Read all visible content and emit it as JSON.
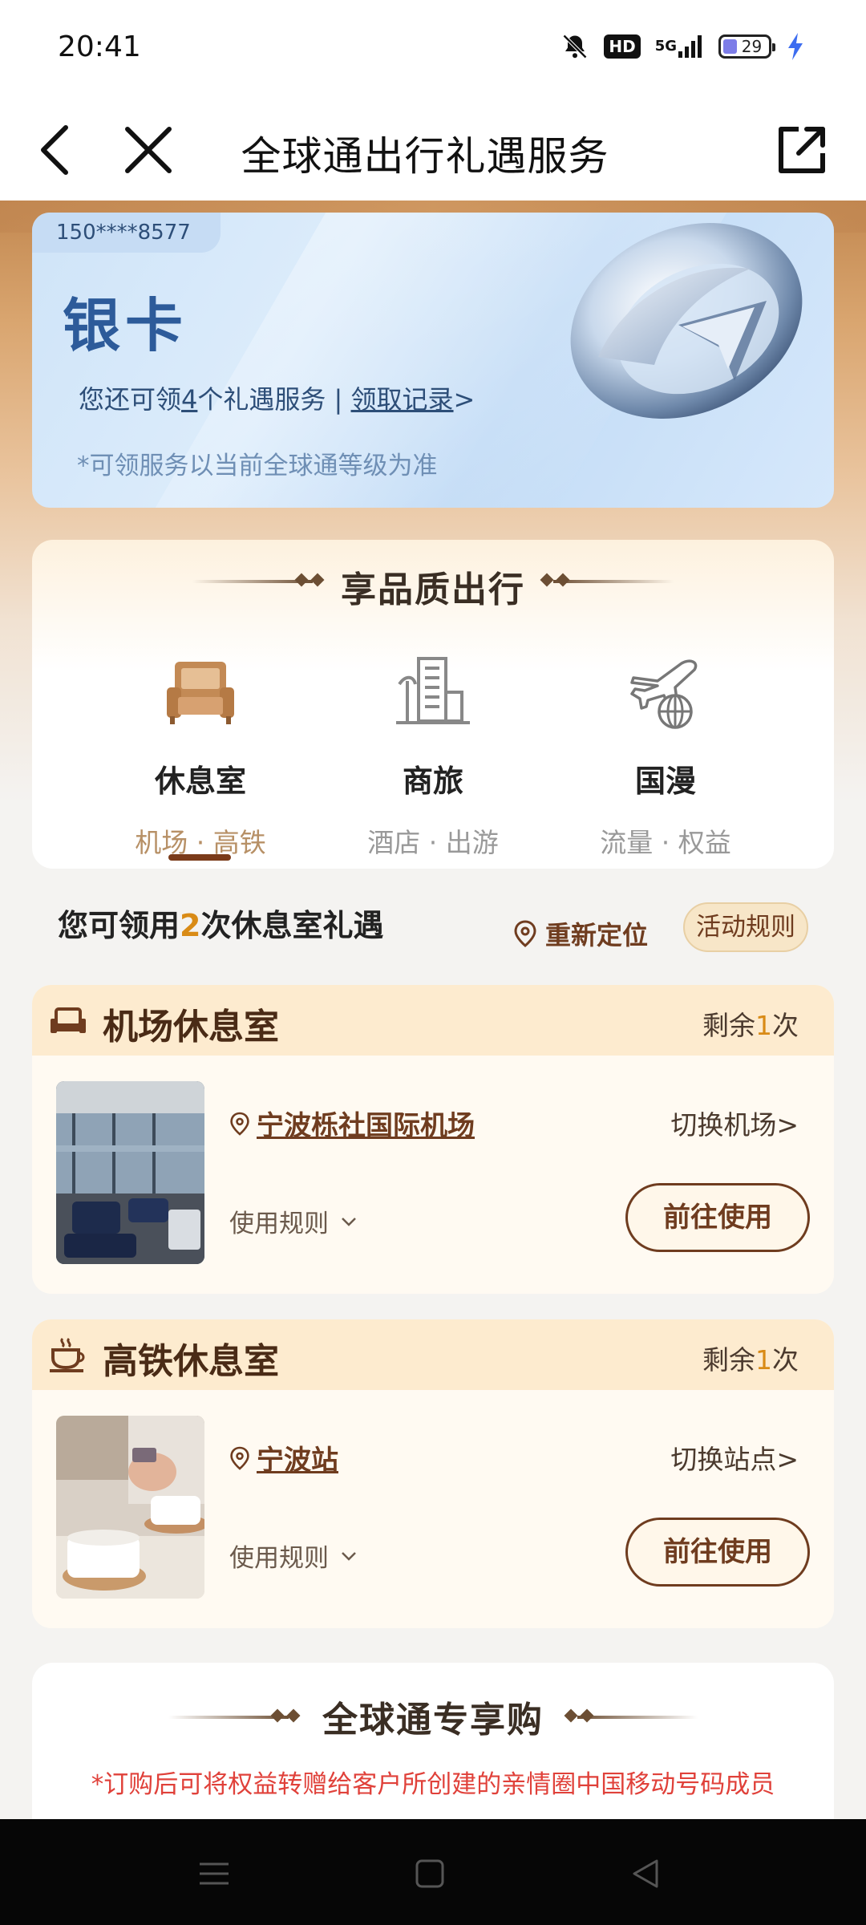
{
  "status_bar": {
    "time": "20:41",
    "hd": "HD",
    "network": "5G",
    "battery": "29",
    "icons": [
      "bell-muted-icon",
      "hd-icon",
      "5g-signal-icon",
      "battery-icon",
      "charging-icon"
    ]
  },
  "nav": {
    "title": "全球通出行礼遇服务",
    "icons": [
      "back-icon",
      "close-icon",
      "share-icon"
    ]
  },
  "member_card": {
    "phone": "150****8577",
    "level": "银卡",
    "info_prefix": "您还可领",
    "info_count": "4",
    "info_suffix": "个礼遇服务 | ",
    "record_link": "领取记录",
    "record_arrow": ">",
    "note": "*可领服务以当前全球通等级为准"
  },
  "quality_section": {
    "title": "享品质出行",
    "categories": [
      {
        "label": "休息室",
        "sub": "机场 · 高铁",
        "icon": "sofa-icon"
      },
      {
        "label": "商旅",
        "sub": "酒店 · 出游",
        "icon": "building-icon"
      },
      {
        "label": "国漫",
        "sub": "流量 · 权益",
        "icon": "plane-globe-icon"
      }
    ]
  },
  "claim": {
    "prefix": "您可领用",
    "count": "2",
    "suffix": "次休息室礼遇",
    "relocate": "重新定位",
    "rules": "活动规则"
  },
  "lounges": [
    {
      "title": "机场休息室",
      "remain_prefix": "剩余",
      "remain_count": "1",
      "remain_suffix": "次",
      "location": "宁波栎社国际机场",
      "switch": "切换机场>",
      "rule": "使用规则",
      "button": "前往使用",
      "icon": "sofa-icon"
    },
    {
      "title": "高铁休息室",
      "remain_prefix": "剩余",
      "remain_count": "1",
      "remain_suffix": "次",
      "location": "宁波站",
      "switch": "切换站点>",
      "rule": "使用规则",
      "button": "前往使用",
      "icon": "coffee-icon"
    }
  ],
  "exclusive": {
    "title": "全球通专享购",
    "note": "*订购后可将权益转赠给客户所创建的亲情圈中国移动号码成员"
  },
  "colors": {
    "accent_brown": "#6f3c1f",
    "highlight_orange": "#d98b16",
    "card_blue": "#cfe4f8",
    "warning_red": "#e0413a"
  }
}
